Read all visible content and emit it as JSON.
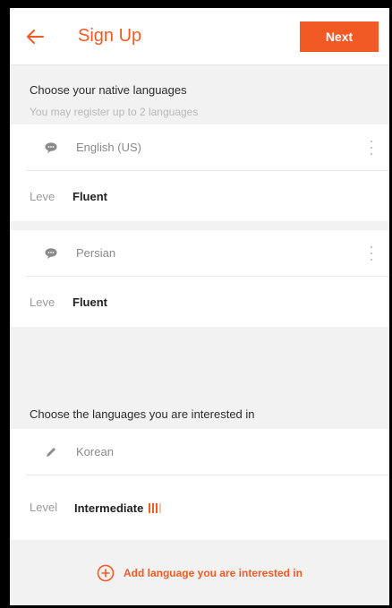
{
  "header": {
    "title": "Sign Up",
    "next_label": "Next",
    "accent_color": "#f25a24"
  },
  "native": {
    "title": "Choose your native languages",
    "subtitle": "You may register up to 2 languages",
    "items": [
      {
        "language": "English (US)",
        "level_label": "Leve",
        "level_value": "Fluent",
        "icon": "speech-bubble-icon"
      },
      {
        "language": "Persian",
        "level_label": "Leve",
        "level_value": "Fluent",
        "icon": "speech-bubble-icon"
      }
    ]
  },
  "interested": {
    "title": "Choose the languages you are interested in",
    "items": [
      {
        "language": "Korean",
        "level_label": "Level",
        "level_value": "Intermediate",
        "icon": "pencil-icon",
        "level_bars_filled": 3,
        "level_bars_total": 4
      }
    ],
    "add_label": "Add language you are interested in"
  }
}
